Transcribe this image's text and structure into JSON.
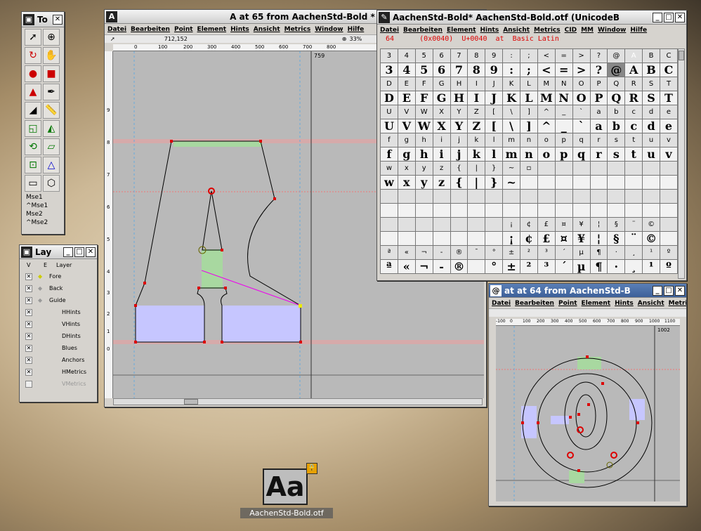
{
  "toolbox": {
    "title": "To",
    "mse": [
      "Mse1",
      "^Mse1",
      "Mse2",
      "^Mse2"
    ]
  },
  "layers": {
    "title": "Lay",
    "col_v": "V",
    "col_e": "E",
    "col_layer": "Layer",
    "items": [
      "Fore",
      "Back",
      "Guide",
      "HHints",
      "VHints",
      "DHints",
      "Blues",
      "Anchors",
      "HMetrics",
      "VMetrics"
    ]
  },
  "glyph_a": {
    "title": "A at 65 from AachenStd-Bold *",
    "menu": [
      "Datei",
      "Bearbeiten",
      "Point",
      "Element",
      "Hints",
      "Ansicht",
      "Metrics",
      "Window",
      "Hilfe"
    ],
    "coords": "712,152",
    "zoom": "33%",
    "ruler": [
      "0",
      "100",
      "200",
      "300",
      "400",
      "500",
      "600",
      "700",
      "800"
    ],
    "width_label": "759",
    "left_ruler": [
      "9",
      "8",
      "7",
      "6",
      "5",
      "4",
      "3",
      "2",
      "1",
      "0"
    ]
  },
  "font": {
    "title": "AachenStd-Bold*  AachenStd-Bold.otf (UnicodeB",
    "menu": [
      "Datei",
      "Bearbeiten",
      "Element",
      "Hints",
      "Ansicht",
      "Metrics",
      "CID",
      "MM",
      "Window",
      "Hilfe"
    ],
    "info": "64      (0x0040)  U+0040  at  Basic Latin",
    "rows": [
      {
        "labels": [
          "3",
          "4",
          "5",
          "6",
          "7",
          "8",
          "9",
          ":",
          ";",
          "<",
          "=",
          ">",
          "?",
          "@",
          "A",
          "B",
          "C"
        ],
        "glyphs": [
          "3",
          "4",
          "5",
          "6",
          "7",
          "8",
          "9",
          ":",
          ";",
          "<",
          "=",
          ">",
          "?",
          "@",
          "A",
          "B",
          "C"
        ]
      },
      {
        "labels": [
          "D",
          "E",
          "F",
          "G",
          "H",
          "I",
          "J",
          "K",
          "L",
          "M",
          "N",
          "O",
          "P",
          "Q",
          "R",
          "S",
          "T"
        ],
        "glyphs": [
          "D",
          "E",
          "F",
          "G",
          "H",
          "I",
          "J",
          "K",
          "L",
          "M",
          "N",
          "O",
          "P",
          "Q",
          "R",
          "S",
          "T"
        ]
      },
      {
        "labels": [
          "U",
          "V",
          "W",
          "X",
          "Y",
          "Z",
          "[",
          "\\",
          "]",
          "^",
          "_",
          "`",
          "a",
          "b",
          "c",
          "d",
          "e"
        ],
        "glyphs": [
          "U",
          "V",
          "W",
          "X",
          "Y",
          "Z",
          "[",
          "\\",
          "]",
          "^",
          "_",
          "`",
          "a",
          "b",
          "c",
          "d",
          "e"
        ]
      },
      {
        "labels": [
          "f",
          "g",
          "h",
          "i",
          "j",
          "k",
          "l",
          "m",
          "n",
          "o",
          "p",
          "q",
          "r",
          "s",
          "t",
          "u",
          "v"
        ],
        "glyphs": [
          "f",
          "g",
          "h",
          "i",
          "j",
          "k",
          "l",
          "m",
          "n",
          "o",
          "p",
          "q",
          "r",
          "s",
          "t",
          "u",
          "v"
        ]
      },
      {
        "labels": [
          "w",
          "x",
          "y",
          "z",
          "{",
          "|",
          "}",
          "~",
          "▫",
          "",
          "",
          "",
          "",
          "",
          "",
          "",
          ""
        ],
        "glyphs": [
          "w",
          "x",
          "y",
          "z",
          "{",
          "|",
          "}",
          "~",
          "",
          "",
          "",
          "",
          "",
          "",
          "",
          "",
          ""
        ]
      },
      {
        "labels": [
          "",
          "",
          "",
          "",
          "",
          "",
          "",
          "",
          "",
          "",
          "",
          "",
          "",
          "",
          "",
          "",
          ""
        ],
        "glyphs": [
          "",
          "",
          "",
          "",
          "",
          "",
          "",
          "",
          "",
          "",
          "",
          "",
          "",
          "",
          "",
          "",
          ""
        ]
      },
      {
        "labels": [
          "",
          "",
          "",
          "",
          "",
          "",
          "",
          "¡",
          "¢",
          "£",
          "¤",
          "¥",
          "¦",
          "§",
          "¨",
          "©",
          ""
        ],
        "glyphs": [
          "",
          "",
          "",
          "",
          "",
          "",
          "",
          "¡",
          "¢",
          "£",
          "¤",
          "¥",
          "¦",
          "§",
          "¨",
          "©",
          ""
        ]
      },
      {
        "labels": [
          "ª",
          "«",
          "¬",
          "-",
          "®",
          "¯",
          "°",
          "±",
          "²",
          "³",
          "´",
          "µ",
          "¶",
          "·",
          "¸",
          "¹",
          "º"
        ],
        "glyphs": [
          "ª",
          "«",
          "¬",
          "-",
          "®",
          "",
          "°",
          "±",
          "²",
          "³",
          "´",
          "µ",
          "¶",
          "·",
          "¸",
          "¹",
          "º"
        ]
      }
    ]
  },
  "glyph_at": {
    "title": "at at 64 from AachenStd-B",
    "menu": [
      "Datei",
      "Bearbeiten",
      "Point",
      "Element",
      "Hints",
      "Ansicht",
      "Metrics"
    ],
    "ruler": [
      "-100",
      "0",
      "100",
      "200",
      "300",
      "400",
      "500",
      "600",
      "700",
      "800",
      "900",
      "1000",
      "1100"
    ],
    "width_label": "1002"
  },
  "desktop_icon": {
    "label": "AachenStd-Bold.otf",
    "glyph": "Aa"
  }
}
